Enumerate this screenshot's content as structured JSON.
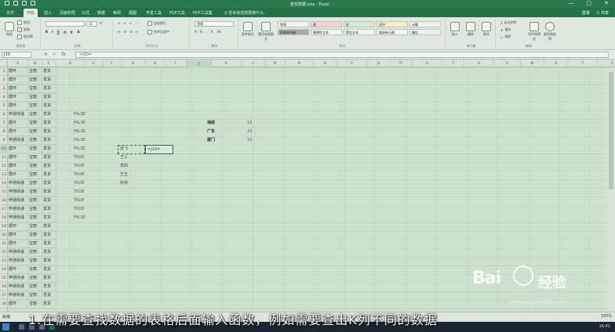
{
  "window": {
    "title": "查找数据.xlsx - Excel",
    "min": "—",
    "max": "▢",
    "close": "✕"
  },
  "tabs": [
    {
      "label": "文件"
    },
    {
      "label": "开始"
    },
    {
      "label": "插入"
    },
    {
      "label": "页面布局"
    },
    {
      "label": "公式"
    },
    {
      "label": "数据"
    },
    {
      "label": "审阅"
    },
    {
      "label": "视图"
    },
    {
      "label": "开发工具"
    },
    {
      "label": "PDF工具"
    },
    {
      "label": "PDF工具集"
    }
  ],
  "tell_me": "告诉我您想要做什么...",
  "user": {
    "login": "登录",
    "share": "共享"
  },
  "ribbon": {
    "clipboard": {
      "label": "剪贴板",
      "paste": "粘贴",
      "cut": "剪切",
      "copy": "复制",
      "format_painter": "格式刷"
    },
    "font": {
      "label": "字体",
      "name": "",
      "size": "11"
    },
    "alignment": {
      "label": "对齐方式",
      "wrap": "自动换行",
      "merge": "合并后居中"
    },
    "number": {
      "label": "数字",
      "format": "常规"
    },
    "styles": {
      "label": "样式",
      "cond_format": "条件格式",
      "table_format": "套用表格格式",
      "cells": [
        {
          "text": "常规",
          "color": "#f3f6f3"
        },
        {
          "text": "差",
          "color": "#f5d2d2"
        },
        {
          "text": "好",
          "color": "#d5ecd0"
        },
        {
          "text": "适中",
          "color": "#f5ebc4"
        },
        {
          "text": "计算",
          "color": "#f0f0f0"
        },
        {
          "text": "检查单元格",
          "color": "#a9a9a9"
        },
        {
          "text": "解释性文本",
          "color": "#f3f6f3"
        },
        {
          "text": "警告文本",
          "color": "#f3f6f3"
        },
        {
          "text": "链接单元格",
          "color": "#f3f6f3"
        },
        {
          "text": "输出",
          "color": "#f0f0f0"
        }
      ]
    },
    "cells": {
      "label": "单元格",
      "insert": "插入",
      "delete": "删除",
      "format": "格式"
    },
    "editing": {
      "label": "编辑",
      "autosum": "自动求和",
      "fill": "填充",
      "clear": "清除",
      "sort": "排序和筛选",
      "find": "查找和选择"
    }
  },
  "formula_bar": {
    "name_box": "J10",
    "cancel": "✕",
    "enter": "✓",
    "fx": "fx",
    "content": "=J10="
  },
  "columns": [
    "A",
    "B",
    "C",
    "D",
    "E",
    "F",
    "G",
    "H",
    "I",
    "J",
    "K",
    "L",
    "M",
    "N",
    "O",
    "P",
    "Q",
    "R",
    "S",
    "T",
    "U",
    "V",
    "W",
    "X",
    "Y",
    "Z",
    "AA"
  ],
  "rows": [
    "1",
    "2",
    "3",
    "4",
    "5",
    "6",
    "7",
    "8",
    "9",
    "10",
    "11",
    "12",
    "13",
    "14",
    "15",
    "16",
    "17",
    "18",
    "19",
    "20",
    "21",
    "22",
    "23",
    "24",
    "25",
    "26",
    "27",
    "28"
  ],
  "colA": [
    "循环",
    "循环",
    "循环",
    "循环",
    "循环",
    "申通快递",
    "循环",
    "循环",
    "申通快递",
    "循环",
    "循环",
    "循环",
    "循环",
    "申通快递",
    "申通快递",
    "申通快递",
    "申通快递",
    "申通快递",
    "循环",
    "循环",
    "循环",
    "申通快递",
    "申通快递",
    "循环",
    "申通快递",
    "申通快递",
    "申通快递",
    "循环"
  ],
  "colB": [
    "宝丽",
    "宝丽",
    "宝丽",
    "宝丽",
    "宝丽",
    "宝丽",
    "宝丽",
    "宝丽",
    "宝丽",
    "宝丽",
    "宝丽",
    "宝丽",
    "宝丽",
    "宝丽",
    "宝丽",
    "宝丽",
    "宝丽",
    "宝丽",
    "宝丽",
    "宝丽",
    "宝丽",
    "宝丽",
    "宝丽",
    "宝丽",
    "宝丽",
    "宝丽",
    "宝丽",
    "宝丽"
  ],
  "colC": [
    "发货",
    "发货",
    "发货",
    "发货",
    "发货",
    "发货",
    "发货",
    "发货",
    "发货",
    "发货",
    "发货",
    "发货",
    "发货",
    "发货",
    "发货",
    "发货",
    "发货",
    "发货",
    "发货",
    "发货",
    "发货",
    "发货",
    "发货",
    "发货",
    "发货",
    "发货",
    "发货",
    "发货"
  ],
  "colD": [
    "",
    "",
    "",
    "",
    "",
    "FALSE",
    "FALSE",
    "FALSE",
    "FALSE",
    "FALSE",
    "TRUE",
    "TRUE",
    "TRUE",
    "TRUE",
    "TRUE",
    "TRUE",
    "TRUE",
    "FALSE",
    "",
    "",
    "",
    "",
    "",
    "",
    "",
    "",
    "",
    ""
  ],
  "names": [
    {
      "text": "张飞",
      "row": 10
    },
    {
      "text": "王三",
      "row": 11
    },
    {
      "text": "李四",
      "row": 12
    },
    {
      "text": "王五",
      "row": 13
    },
    {
      "text": "张林",
      "row": 14
    }
  ],
  "edit_formula": "=J10=",
  "places": [
    {
      "city": "海南",
      "value": "15"
    },
    {
      "city": "广东",
      "value": "15"
    },
    {
      "city": "厦门",
      "value": "15"
    }
  ],
  "subtitle": "1.在需要查找数据的表格后面输入函数，例如需要查出K列不同的数据",
  "sheetbar": {
    "ready": "就绪",
    "zoom": "100%"
  },
  "taskbar": {
    "clock": "16:41"
  },
  "watermark": {
    "logo": "Bai",
    "jingyan": "经验",
    "url": "jingyan.baidu.com"
  }
}
